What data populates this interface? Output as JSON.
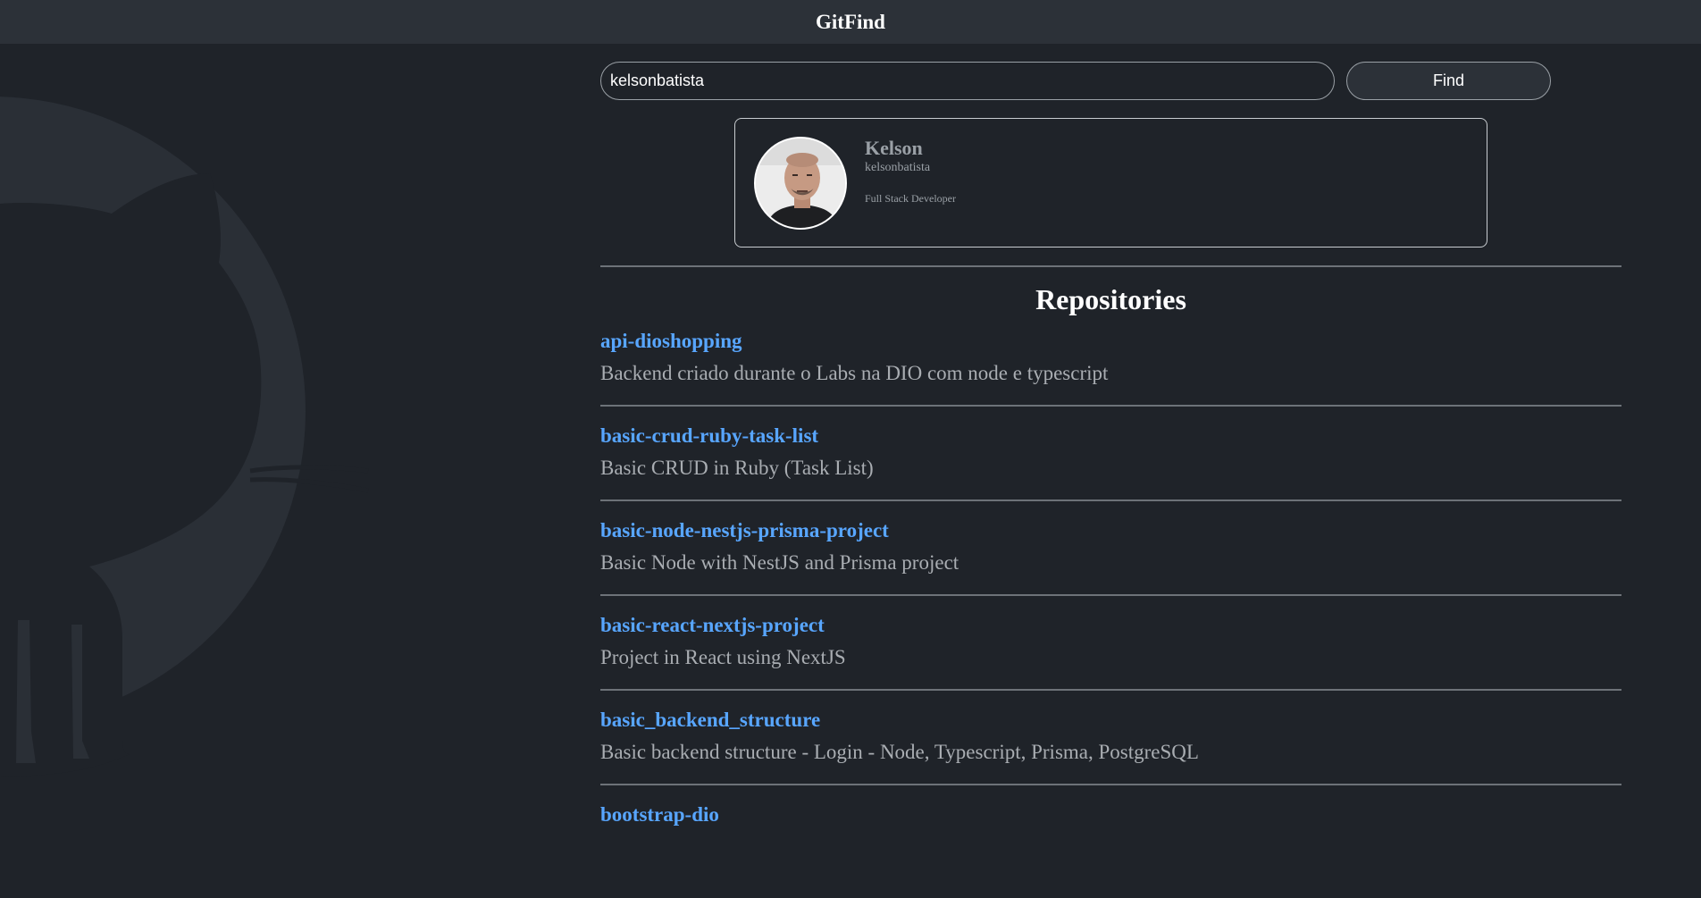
{
  "header": {
    "title": "GitFind"
  },
  "search": {
    "value": "kelsonbatista",
    "button_label": "Find"
  },
  "profile": {
    "name": "Kelson",
    "login": "kelsonbatista",
    "bio": "Full Stack Developer"
  },
  "repositories": {
    "title": "Repositories",
    "items": [
      {
        "name": "api-dioshopping",
        "description": "Backend criado durante o Labs na DIO com node e typescript"
      },
      {
        "name": "basic-crud-ruby-task-list",
        "description": "Basic CRUD in Ruby (Task List)"
      },
      {
        "name": "basic-node-nestjs-prisma-project",
        "description": "Basic Node with NestJS and Prisma project"
      },
      {
        "name": "basic-react-nextjs-project",
        "description": "Project in React using NextJS"
      },
      {
        "name": "basic_backend_structure",
        "description": "Basic backend structure - Login - Node, Typescript, Prisma, PostgreSQL"
      },
      {
        "name": "bootstrap-dio",
        "description": ""
      }
    ]
  },
  "colors": {
    "background": "#1f2329",
    "header": "#2c3138",
    "link": "#58a6ff",
    "muted_text": "#a9adb2"
  }
}
